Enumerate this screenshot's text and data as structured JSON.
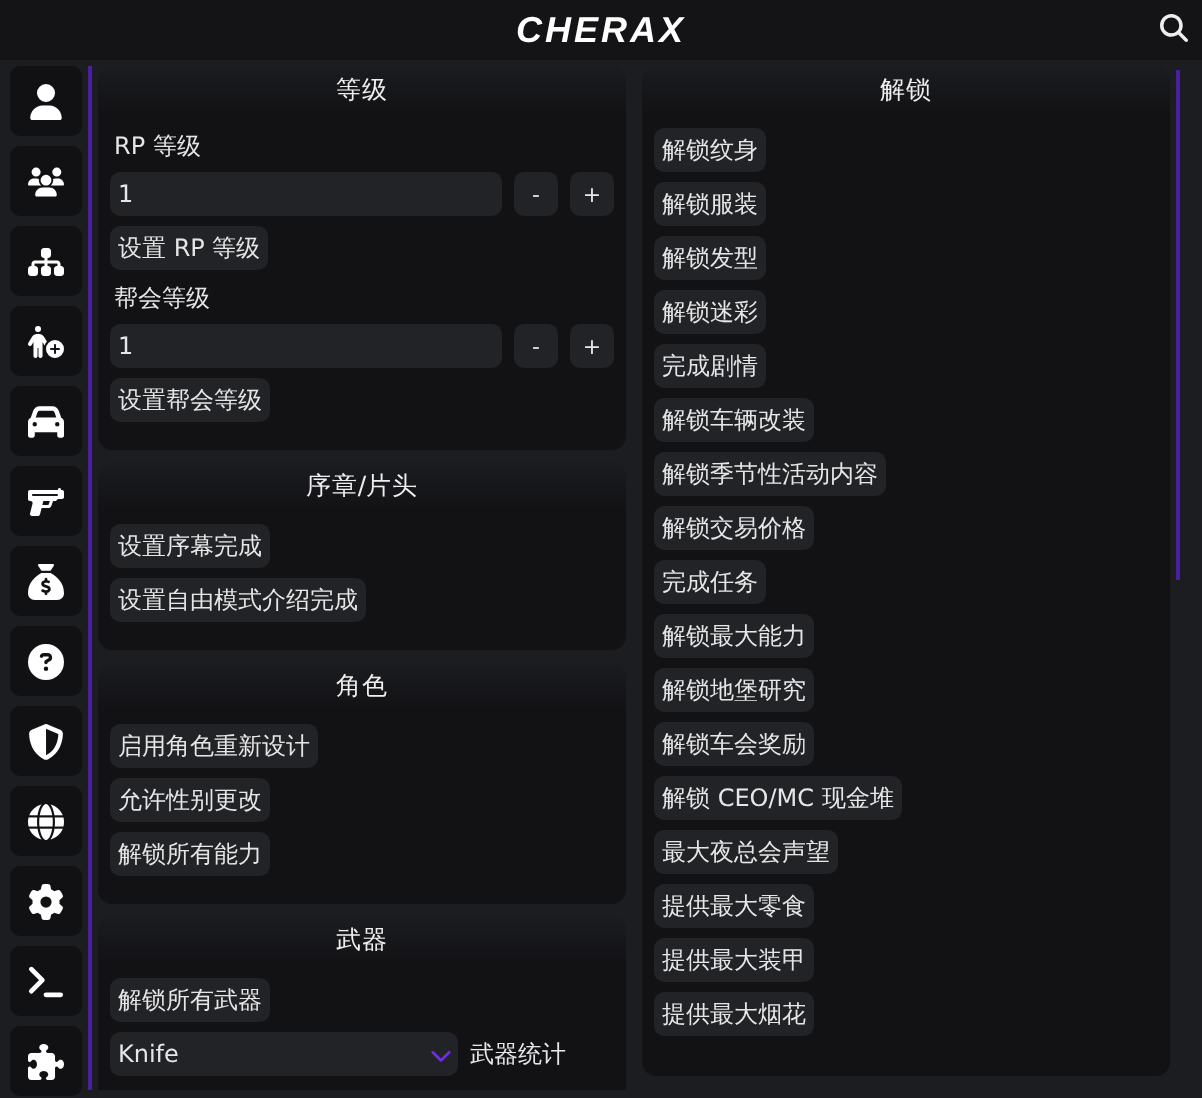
{
  "header": {
    "title": "CHERAX"
  },
  "sidebar": {
    "items": [
      {
        "kind": "user"
      },
      {
        "kind": "users"
      },
      {
        "kind": "network"
      },
      {
        "kind": "person-add"
      },
      {
        "kind": "car"
      },
      {
        "kind": "gun"
      },
      {
        "kind": "money"
      },
      {
        "kind": "help"
      },
      {
        "kind": "shield"
      },
      {
        "kind": "globe"
      },
      {
        "kind": "settings"
      },
      {
        "kind": "terminal"
      },
      {
        "kind": "puzzle"
      }
    ]
  },
  "left_sections": [
    {
      "title": "等级",
      "items": [
        {
          "kind": "label",
          "text": "RP 等级"
        },
        {
          "kind": "stepper",
          "value": "1",
          "minus": "-",
          "plus": "+"
        },
        {
          "kind": "button",
          "text": "设置 RP 等级"
        },
        {
          "kind": "label",
          "text": "帮会等级"
        },
        {
          "kind": "stepper",
          "value": "1",
          "minus": "-",
          "plus": "+"
        },
        {
          "kind": "button",
          "text": "设置帮会等级"
        }
      ]
    },
    {
      "title": "序章/片头",
      "items": [
        {
          "kind": "button",
          "text": "设置序幕完成"
        },
        {
          "kind": "button",
          "text": "设置自由模式介绍完成"
        }
      ]
    },
    {
      "title": "角色",
      "items": [
        {
          "kind": "button",
          "text": "启用角色重新设计"
        },
        {
          "kind": "button",
          "text": "允许性别更改"
        },
        {
          "kind": "button",
          "text": "解锁所有能力"
        }
      ]
    },
    {
      "title": "武器",
      "items": [
        {
          "kind": "button",
          "text": "解锁所有武器"
        },
        {
          "kind": "select",
          "value": "Knife",
          "label": "武器统计"
        }
      ]
    }
  ],
  "right_section": {
    "title": "解锁",
    "buttons": [
      "解锁纹身",
      "解锁服装",
      "解锁发型",
      "解锁迷彩",
      "完成剧情",
      "解锁车辆改装",
      "解锁季节性活动内容",
      "解锁交易价格",
      "完成任务",
      "解锁最大能力",
      "解锁地堡研究",
      "解锁车会奖励",
      "解锁 CEO/MC 现金堆",
      "最大夜总会声望",
      "提供最大零食",
      "提供最大装甲",
      "提供最大烟花"
    ]
  }
}
